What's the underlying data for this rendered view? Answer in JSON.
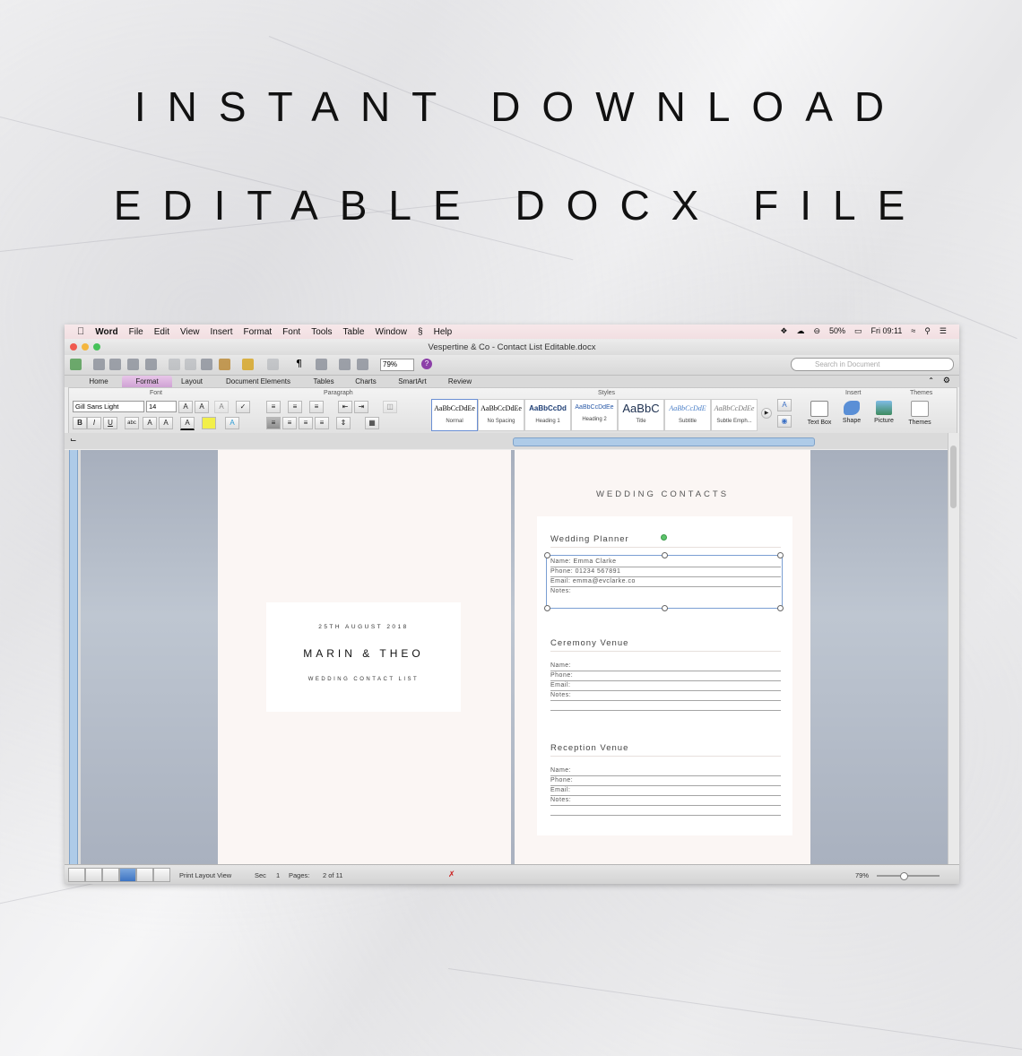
{
  "headline": {
    "line1": "INSTANT DOWNLOAD",
    "line2": "EDITABLE DOCX FILE"
  },
  "menubar": {
    "app": "Word",
    "items": [
      "File",
      "Edit",
      "View",
      "Insert",
      "Format",
      "Font",
      "Tools",
      "Table",
      "Window",
      "Help"
    ],
    "battery": "50%",
    "clock": "Fri 09:11"
  },
  "window": {
    "title": "Vespertine & Co - Contact List Editable.docx"
  },
  "toolbar": {
    "zoom": "79%",
    "search_placeholder": "Search in Document",
    "help_label": "?"
  },
  "tabs": [
    "Home",
    "Format",
    "Layout",
    "Document Elements",
    "Tables",
    "Charts",
    "SmartArt",
    "Review"
  ],
  "ribbon": {
    "groups": {
      "font": "Font",
      "paragraph": "Paragraph",
      "styles": "Styles",
      "insert": "Insert",
      "themes": "Themes"
    },
    "font_name": "Gill Sans Light",
    "font_size": "14",
    "format_buttons": [
      "B",
      "I",
      "U"
    ],
    "styles": [
      {
        "preview": "AaBbCcDdEe",
        "label": "Normal"
      },
      {
        "preview": "AaBbCcDdEe",
        "label": "No Spacing"
      },
      {
        "preview": "AaBbCcDd",
        "label": "Heading 1"
      },
      {
        "preview": "AaBbCcDdEe",
        "label": "Heading 2"
      },
      {
        "preview": "AaBbC",
        "label": "Title"
      },
      {
        "preview": "AaBbCcDdE",
        "label": "Subtitle"
      },
      {
        "preview": "AaBbCcDdEe",
        "label": "Subtle Emph..."
      }
    ],
    "insert_items": [
      "Text Box",
      "Shape",
      "Picture"
    ],
    "themes_label": "Themes"
  },
  "cover": {
    "date": "25TH AUGUST 2018",
    "names": "MARIN & THEO",
    "subtitle": "WEDDING CONTACT LIST"
  },
  "contacts": {
    "title": "WEDDING CONTACTS",
    "sections": [
      {
        "heading": "Wedding Planner",
        "name": "Name: Emma Clarke",
        "phone": "Phone: 01234 567891",
        "email": "Email: emma@evclarke.co",
        "notes": "Notes:"
      },
      {
        "heading": "Ceremony Venue",
        "name": "Name:",
        "phone": "Phone:",
        "email": "Email:",
        "notes": "Notes:"
      },
      {
        "heading": "Reception Venue",
        "name": "Name:",
        "phone": "Phone:",
        "email": "Email:",
        "notes": "Notes:"
      }
    ]
  },
  "statusbar": {
    "view": "Print Layout View",
    "sec_label": "Sec",
    "sec": "1",
    "pages_label": "Pages:",
    "pages": "2 of 11",
    "zoom": "79%"
  },
  "colors": {
    "accent_tab": "#cfa2d4",
    "workspace": "#b3bbc8",
    "page": "#fbf6f4",
    "selection": "#7b9fd3"
  }
}
